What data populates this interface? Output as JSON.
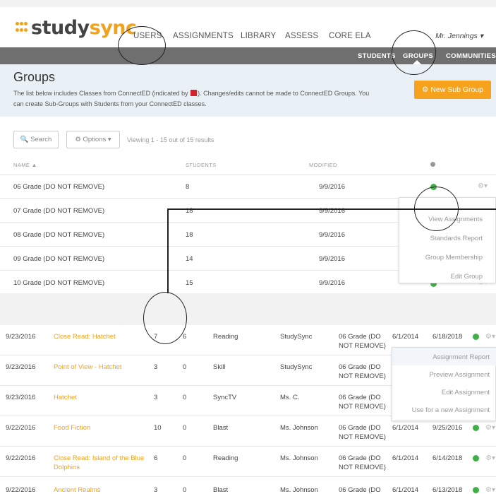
{
  "logo": {
    "part1": "study",
    "part2": "sync"
  },
  "nav": {
    "users": "USERS",
    "assignments": "ASSIGNMENTS",
    "library": "LIBRARY",
    "assess": "ASSESS",
    "core_ela": "CORE ELA",
    "user": "Mr. Jennings ▾"
  },
  "subnav": {
    "students": "STUDENTS",
    "groups": "GROUPS",
    "communities": "COMMUNITIES"
  },
  "groups_page": {
    "title": "Groups",
    "desc_part1": "The list below includes Classes from ConnectED (indicated by",
    "desc_part2": "). Changes/edits cannot be made to ConnectED Groups. You can create Sub-Groups with Students from your ConnectED classes.",
    "new_sub_group": "⚙ New Sub Group",
    "search": "🔍 Search",
    "options": "⚙ Options ▾",
    "viewing": "Viewing 1 - 15 out of 15 results"
  },
  "groups_table": {
    "headers": {
      "name": "NAME ▲",
      "students": "STUDENTS",
      "modified": "MODIFIED"
    },
    "rows": [
      {
        "name": "06 Grade (DO NOT REMOVE)",
        "students": "8",
        "modified": "9/9/2016"
      },
      {
        "name": "07 Grade (DO NOT REMOVE)",
        "students": "18",
        "modified": "9/9/2016"
      },
      {
        "name": "08 Grade (DO NOT REMOVE)",
        "students": "18",
        "modified": "9/9/2016"
      },
      {
        "name": "09 Grade (DO NOT REMOVE)",
        "students": "14",
        "modified": "9/9/2016"
      },
      {
        "name": "10 Grade (DO NOT REMOVE)",
        "students": "15",
        "modified": "9/9/2016"
      }
    ]
  },
  "group_dropdown": [
    "View Assignments",
    "Standards Report",
    "Group Membership",
    "Edit Group"
  ],
  "assignments_table": {
    "rows": [
      {
        "date": "9/23/2016",
        "title": "Close Read: Hatchet",
        "n1": "7",
        "n2": "6",
        "type": "Reading",
        "author": "StudySync",
        "group": "06 Grade (DO NOT REMOVE)",
        "start": "6/1/2014",
        "end": "6/18/2018"
      },
      {
        "date": "9/23/2016",
        "title": "Point of View - Hatchet",
        "n1": "3",
        "n2": "0",
        "type": "Skill",
        "author": "StudySync",
        "group": "06 Grade (DO NOT REMOVE)",
        "start": "",
        "end": ""
      },
      {
        "date": "9/23/2016",
        "title": "Hatchet",
        "n1": "3",
        "n2": "0",
        "type": "SyncTV",
        "author": "Ms. C.",
        "group": "06 Grade (DO NOT REMOVE)",
        "start": "",
        "end": ""
      },
      {
        "date": "9/22/2016",
        "title": "Food Fiction",
        "n1": "10",
        "n2": "0",
        "type": "Blast",
        "author": "Ms. Johnson",
        "group": "06 Grade (DO NOT REMOVE)",
        "start": "6/1/2014",
        "end": "9/25/2016"
      },
      {
        "date": "9/22/2016",
        "title": "Close Read: Island of the Blue Dolphins",
        "n1": "6",
        "n2": "0",
        "type": "Reading",
        "author": "Ms. Johnson",
        "group": "06 Grade (DO NOT REMOVE)",
        "start": "6/1/2014",
        "end": "6/14/2018"
      },
      {
        "date": "9/22/2016",
        "title": "Ancient Realms",
        "n1": "3",
        "n2": "0",
        "type": "Blast",
        "author": "Ms. Johnson",
        "group": "06 Grade (DO",
        "start": "6/1/2014",
        "end": "6/13/2018"
      }
    ]
  },
  "assignment_dropdown": [
    "Assignment Report",
    "Preview Assignment",
    "Edit Assignment",
    "Use for a new Assignment"
  ],
  "colors": {
    "brand_orange": "#f0a21e",
    "check_green": "#3fb047",
    "subnav_gray": "#6f6f6f"
  }
}
